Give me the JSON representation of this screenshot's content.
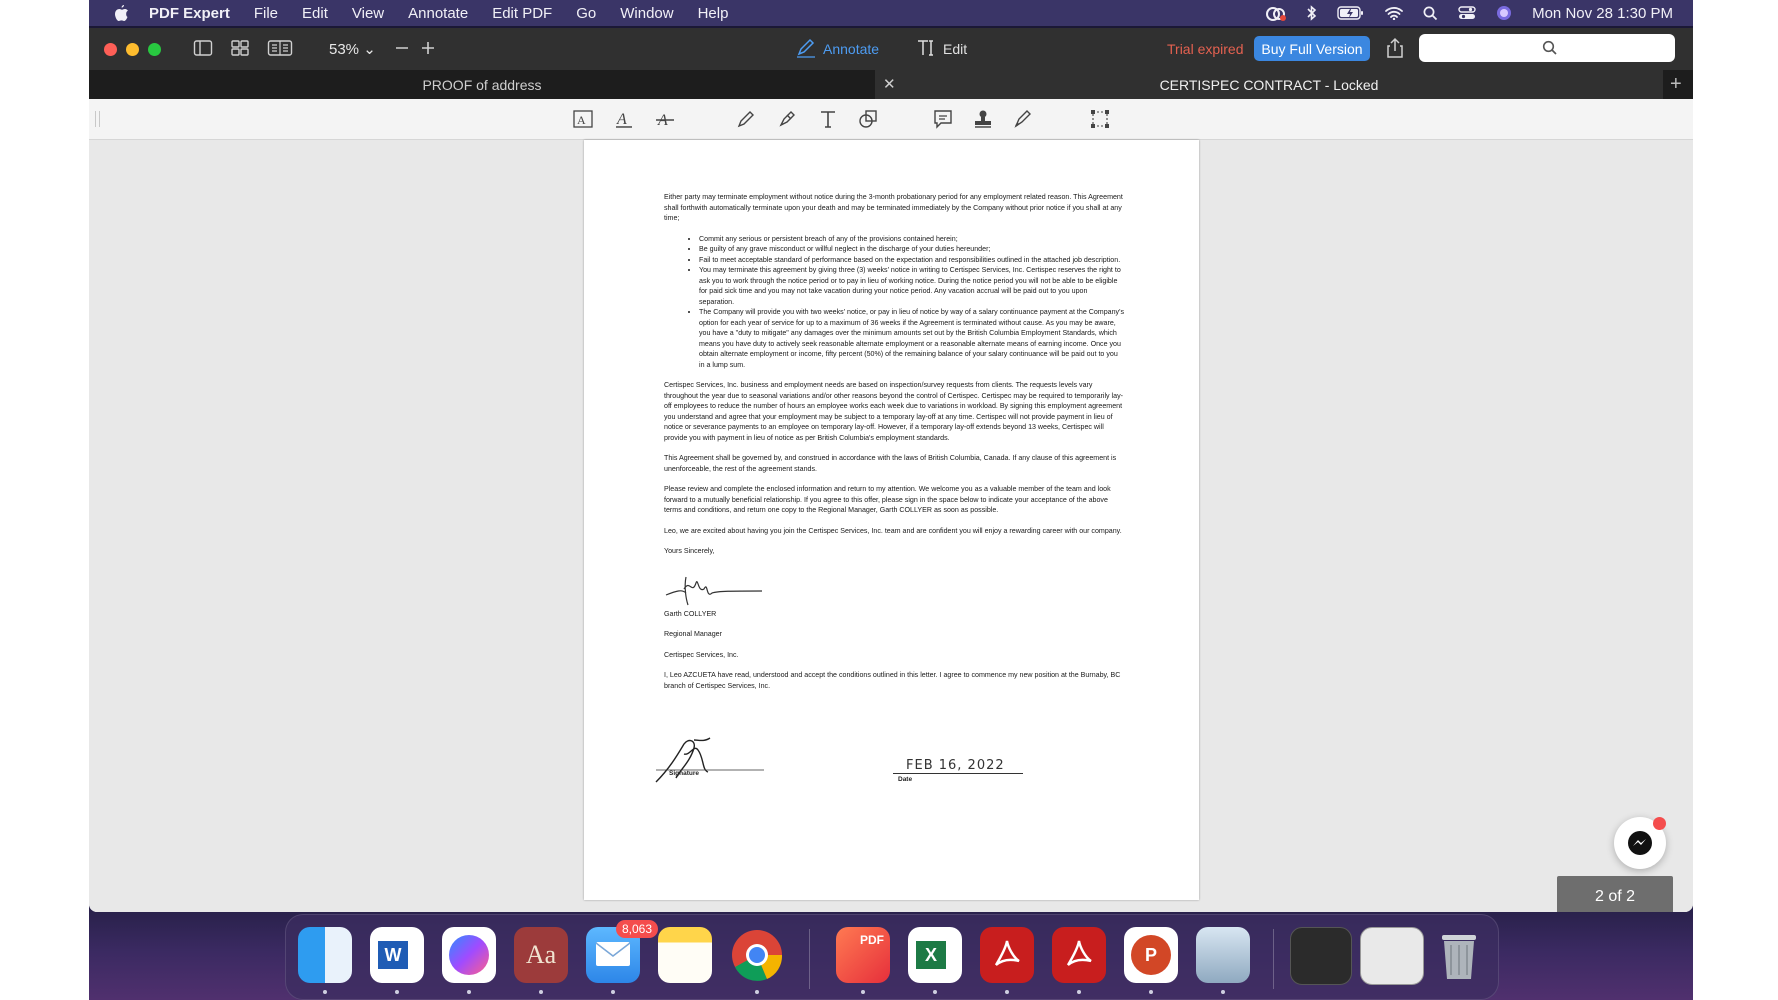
{
  "menubar": {
    "app_name": "PDF Expert",
    "items": [
      "File",
      "Edit",
      "View",
      "Annotate",
      "Edit PDF",
      "Go",
      "Window",
      "Help"
    ],
    "clock": "Mon Nov 28  1:30 PM"
  },
  "toolbar": {
    "zoom": "53%",
    "annotate_label": "Annotate",
    "edit_label": "Edit",
    "trial_text": "Trial expired",
    "buy_label": "Buy Full Version",
    "accent": "#3b87e0"
  },
  "tabs": [
    {
      "label": "PROOF of address"
    },
    {
      "label": "CERTISPEC CONTRACT - Locked"
    }
  ],
  "document": {
    "intro": "Either party may terminate employment without notice during the 3-month probationary period for any employment related reason. This Agreement shall forthwith automatically terminate upon your death and may be terminated immediately by the Company without prior notice if you shall at any time;",
    "bullets": [
      "Commit any serious or persistent breach of any of the provisions contained herein;",
      "Be guilty of any grave misconduct or willful neglect in the discharge of your duties hereunder;",
      "Fail to meet acceptable standard of performance based on the expectation and responsibilities outlined in the attached job description.",
      "You may terminate this agreement by giving three (3) weeks' notice in writing to Certispec Services, Inc. Certispec reserves the right to ask you to work through the notice period or to pay in lieu of working notice. During the notice period you will not be able to be eligible for paid sick time and you may not take vacation during your notice period. Any vacation accrual will be paid out to you upon separation.",
      "The Company will provide you with two weeks' notice, or pay in lieu of notice by way of a salary continuance payment at the Company's option for each year of service for up to a maximum of 36 weeks if the Agreement is terminated without cause. As you may be aware, you have a \"duty to mitigate\" any damages over the minimum amounts set out by the British Columbia Employment Standards, which means you have duty to actively seek reasonable alternate employment or a reasonable alternate means of earning income. Once you obtain alternate employment or income, fifty percent (50%) of the remaining balance of your salary continuance will be paid out to you in a lump sum."
    ],
    "para2": "Certispec Services, Inc. business and employment needs are based on inspection/survey requests from clients. The requests levels vary throughout the year due to seasonal variations and/or other reasons beyond the control of Certispec. Certispec may be required to temporarily lay-off employees to reduce the number of hours an employee works each week due to variations in workload. By signing this employment agreement you understand and agree that your employment may be subject to a temporary lay-off at any time. Certispec will not provide payment in lieu of notice or severance payments to an employee on temporary lay-off. However, if a temporary lay-off extends beyond 13 weeks, Certispec will provide you with payment in lieu of notice as per British Columbia's employment standards.",
    "para3": "This Agreement shall be governed by, and construed in accordance with the laws of British Columbia, Canada. If any clause of this agreement is unenforceable, the rest of the agreement stands.",
    "para4": "Please review and complete the enclosed information and return to my attention. We welcome you as a valuable member of the team and look forward to a mutually beneficial relationship. If you agree to this offer, please sign in the space below to indicate your acceptance of the above terms and conditions, and return one copy to the Regional Manager, Garth COLLYER as soon as possible.",
    "para5": "Leo, we are excited about having you join the Certispec Services, Inc. team and are confident you will enjoy a rewarding career with our company.",
    "closing": "Yours Sincerely,",
    "signer_name": "Garth COLLYER",
    "signer_title": "Regional Manager",
    "signer_company": "Certispec Services, Inc.",
    "acceptance": "I, Leo AZCUETA have read, understood and accept the conditions outlined in this letter. I agree to commence my new position at the Burnaby, BC branch of Certispec Services, Inc.",
    "signature_label": "Signature",
    "date_label": "Date",
    "date_handwritten": "FEB 16, 2022"
  },
  "page_counter": "2 of 2",
  "dock": {
    "mail_badge": "8,063",
    "apps": [
      "finder-icon",
      "word-icon",
      "messenger-icon",
      "dictionary-icon",
      "mail-icon",
      "notes-icon",
      "chrome-icon",
      "pdf-expert-icon",
      "excel-icon",
      "acrobat-icon",
      "acrobat-reader-icon",
      "powerpoint-icon",
      "preview-icon",
      "trash-icon"
    ]
  }
}
